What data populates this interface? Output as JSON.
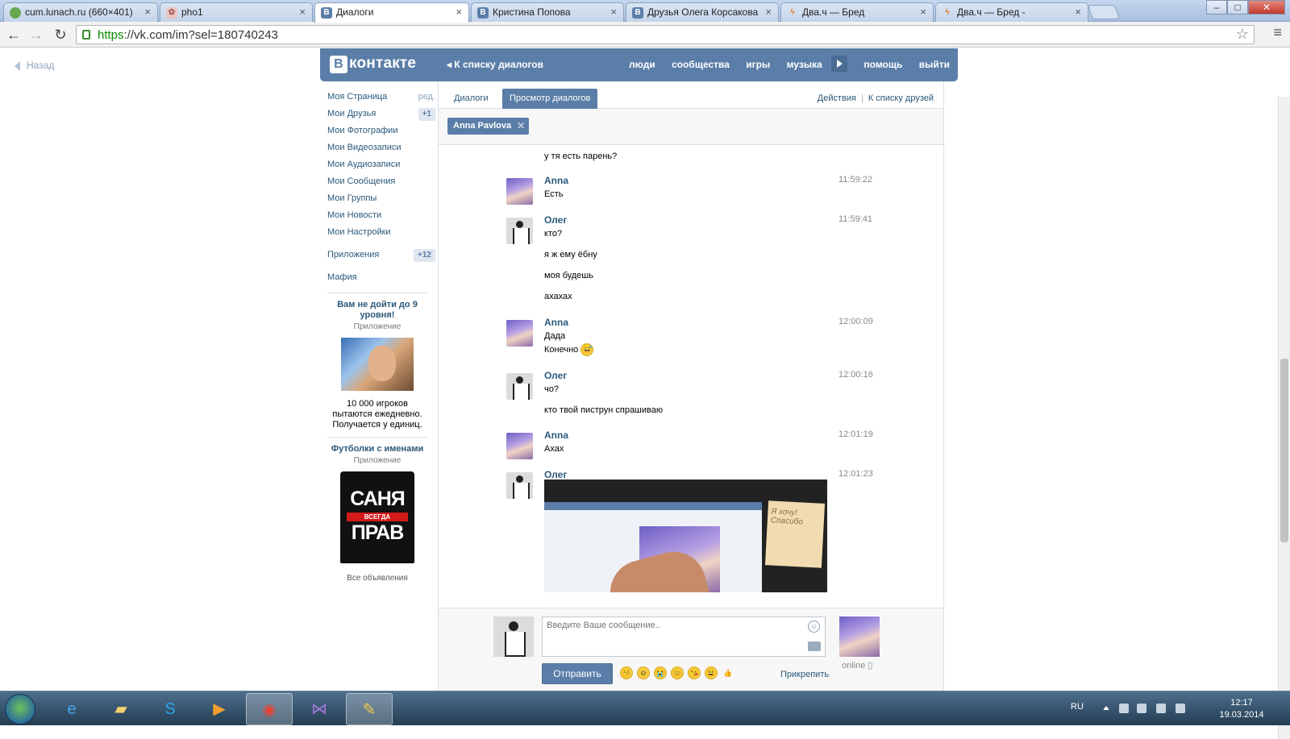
{
  "browser": {
    "tabs": [
      {
        "label": "cum.lunach.ru (660×401)",
        "icon": "globe-green-icon",
        "active": false
      },
      {
        "label": "pho1",
        "icon": "image-icon",
        "active": false
      },
      {
        "label": "Диалоги",
        "icon": "vk-icon",
        "active": true
      },
      {
        "label": "Кристина Попова",
        "icon": "vk-icon",
        "active": false
      },
      {
        "label": "Друзья Олега Корсакова",
        "icon": "vk-icon",
        "active": false
      },
      {
        "label": "Два.ч — Бред",
        "icon": "lightning-icon",
        "active": false
      },
      {
        "label": "Два.ч — Бред -",
        "icon": "lightning-icon",
        "active": false
      }
    ],
    "tab_close": "×",
    "url_scheme": "https",
    "url_rest": "://vk.com/im?sel=180740243",
    "window_buttons": [
      "–",
      "□",
      "✕"
    ]
  },
  "page": {
    "back_label": "Назад",
    "header": {
      "logo_mark": "В",
      "logo_text": "контакте",
      "to_list": "К списку диалогов",
      "nav": [
        "люди",
        "сообщества",
        "игры",
        "музыка",
        "помощь",
        "выйти"
      ]
    },
    "left_menu": {
      "items": [
        {
          "label": "Моя Страница",
          "aux": "ред."
        },
        {
          "label": "Мои Друзья",
          "count": "+1"
        },
        {
          "label": "Мои Фотографии"
        },
        {
          "label": "Мои Видеозаписи"
        },
        {
          "label": "Мои Аудиозаписи"
        },
        {
          "label": "Мои Сообщения"
        },
        {
          "label": "Мои Группы"
        },
        {
          "label": "Мои Новости"
        },
        {
          "label": "Мои Настройки"
        }
      ],
      "apps": {
        "label": "Приложения",
        "count": "+12"
      },
      "mafia": "Мафия",
      "ads": [
        {
          "title": "Вам не дойти до 9 уровня!",
          "subtitle": "Приложение",
          "text": "10 000 игроков пытаются ежедневно. Получается у единиц."
        },
        {
          "title": "Футболки с именами",
          "subtitle": "Приложение",
          "shirt_line1": "САНЯ",
          "shirt_line2": "ВСЕГДА",
          "shirt_line3": "ПРАВ"
        }
      ],
      "all_ads": "Все объявления"
    },
    "dialogs": {
      "tabs": {
        "dialogs": "Диалоги",
        "view": "Просмотр диалогов"
      },
      "actions": "Действия",
      "to_friends": "К списку друзей",
      "peer_chip": "Anna Pavlova",
      "peer_chip_close": "✕",
      "history": {
        "prev_line": "у тя есть парень?",
        "messages": [
          {
            "author": "Anna",
            "time": "11:59:22",
            "lines": [
              "Есть"
            ]
          },
          {
            "author": "Олег",
            "time": "11:59:41",
            "lines": [
              "кто?",
              "я ж ему ёбну",
              "моя будешь",
              "ахахах"
            ]
          },
          {
            "author": "Anna",
            "time": "12:00:09",
            "lines": [
              "Дада",
              "Конечно"
            ]
          },
          {
            "author": "Олег",
            "time": "12:00:16",
            "lines": [
              "чо?",
              "кто твой пиструн спрашиваю"
            ]
          },
          {
            "author": "Anna",
            "time": "12:01:19",
            "lines": [
              "Ахах"
            ]
          },
          {
            "author": "Олег",
            "time": "12:01:23",
            "lines": []
          }
        ],
        "photo_note": "Я хочу! Спасибо"
      },
      "composer": {
        "placeholder": "Введите Ваше сообщение..",
        "send": "Отправить",
        "attach": "Прикрепить",
        "online": "online",
        "emojis": [
          "😚",
          "☺",
          "😭",
          "😊",
          "😘",
          "😫",
          "👍"
        ]
      }
    }
  },
  "taskbar": {
    "lang": "RU",
    "time": "12:17",
    "date": "19.03.2014",
    "apps": [
      "ie-icon",
      "folder-icon",
      "skype-icon",
      "media-player-icon",
      "chrome-icon",
      "visual-studio-icon",
      "paint-icon"
    ]
  },
  "colors": {
    "vk_blue": "#5b7ea8",
    "link": "#2b587a",
    "muted": "#888888"
  }
}
